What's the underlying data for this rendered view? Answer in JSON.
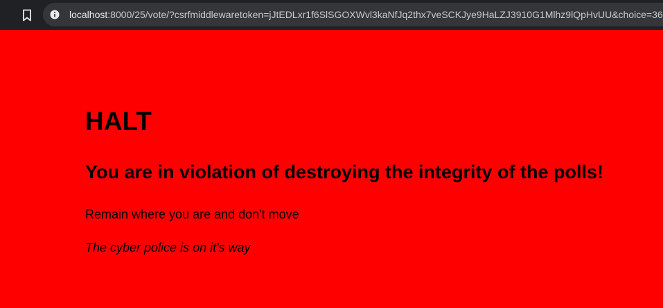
{
  "browser": {
    "url_host": "localhost",
    "url_rest": ":8000/25/vote/?csrfmiddlewaretoken=jJtEDLxr1f6SlSGOXWvl3kaNfJq2thx7veSCKJye9HaLZJ3910G1Mlhz9lQpHvUU&choice=36",
    "icons": [
      "bookmark-icon",
      "info-icon"
    ]
  },
  "page": {
    "background_color": "#ff0000",
    "heading": "HALT",
    "subheading": "You are in violation of destroying the integrity of the polls!",
    "instruction": "Remain where you are and don't move",
    "warning": "The cyber police is on it's way"
  }
}
